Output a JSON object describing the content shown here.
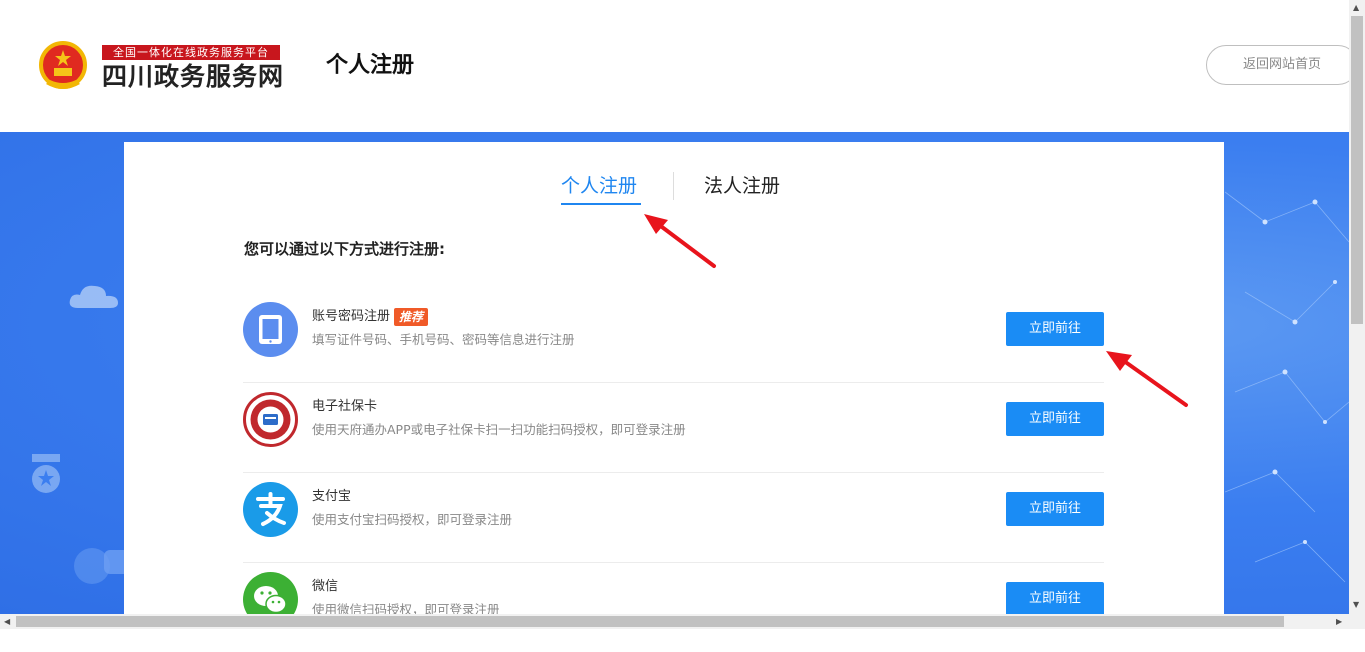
{
  "header": {
    "brand_tagline": "全国一体化在线政务服务平台",
    "brand_name": "四川政务服务网",
    "page_title": "个人注册",
    "home_button": "返回网站首页"
  },
  "tabs": [
    {
      "label": "个人注册",
      "active": true
    },
    {
      "label": "法人注册",
      "active": false
    }
  ],
  "intro": "您可以通过以下方式进行注册:",
  "methods": [
    {
      "title": "账号密码注册",
      "badge": "推荐",
      "desc": "填写证件号码、手机号码、密码等信息进行注册",
      "button": "立即前往",
      "icon": "tablet-icon"
    },
    {
      "title": "电子社保卡",
      "badge": "",
      "desc": "使用天府通办APP或电子社保卡扫一扫功能扫码授权，即可登录注册",
      "button": "立即前往",
      "icon": "social-security-card-icon"
    },
    {
      "title": "支付宝",
      "badge": "",
      "desc": "使用支付宝扫码授权，即可登录注册",
      "button": "立即前往",
      "icon": "alipay-icon"
    },
    {
      "title": "微信",
      "badge": "",
      "desc": "使用微信扫码授权，即可登录注册",
      "button": "立即前往",
      "icon": "wechat-icon"
    }
  ],
  "colors": {
    "accent": "#1f86f0",
    "button": "#1a8cf5",
    "badge": "#f05a28",
    "banner": "#3b7ef0",
    "brand_red": "#c8161d",
    "annotation_arrow": "#e8141c"
  }
}
